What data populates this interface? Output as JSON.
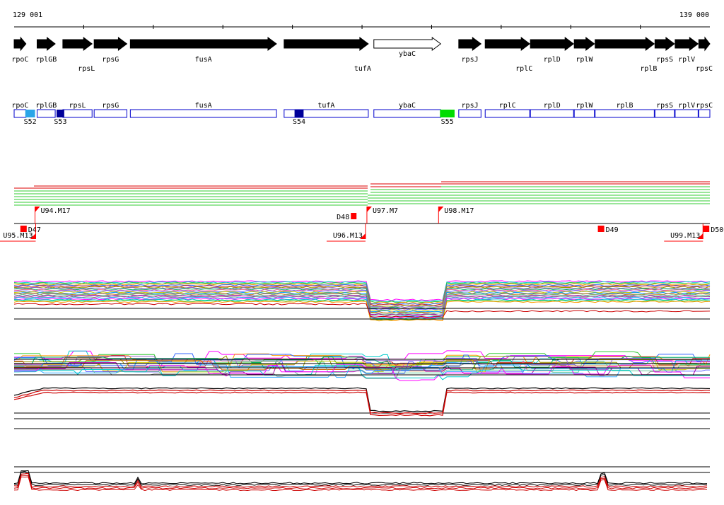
{
  "coords": {
    "start_label": "129 001",
    "end_label": "139 000",
    "start": 129001,
    "end": 139000
  },
  "genes": [
    {
      "name": "rpoC",
      "start": 129001,
      "end": 129171,
      "strand": "+",
      "label_row": "below",
      "filled": true
    },
    {
      "name": "rplGB",
      "start": 129331,
      "end": 129591,
      "strand": "+",
      "label_row": "below",
      "filled": true
    },
    {
      "name": "rpsL",
      "start": 129701,
      "end": 130121,
      "strand": "+",
      "label_row": "below2",
      "filled": true
    },
    {
      "name": "rpsG",
      "start": 130151,
      "end": 130621,
      "strand": "+",
      "label_row": "below",
      "filled": true
    },
    {
      "name": "fusA",
      "start": 130671,
      "end": 132771,
      "strand": "+",
      "label_row": "below",
      "filled": true
    },
    {
      "name": "tufA",
      "start": 132881,
      "end": 134091,
      "strand": "+",
      "label_row": "below2",
      "filled": true
    },
    {
      "name": "ybaC",
      "start": 134171,
      "end": 135131,
      "strand": "+",
      "label_row": "above",
      "filled": false
    },
    {
      "name": "rpsJ",
      "start": 135391,
      "end": 135711,
      "strand": "+",
      "label_row": "below",
      "filled": true
    },
    {
      "name": "rplC",
      "start": 135771,
      "end": 136411,
      "strand": "+",
      "label_row": "below2",
      "filled": true
    },
    {
      "name": "rplD",
      "start": 136421,
      "end": 137041,
      "strand": "+",
      "label_row": "below",
      "filled": true
    },
    {
      "name": "rplW",
      "start": 137051,
      "end": 137341,
      "strand": "+",
      "label_row": "below",
      "filled": true
    },
    {
      "name": "rplB",
      "start": 137351,
      "end": 138201,
      "strand": "+",
      "label_row": "below2",
      "filled": true
    },
    {
      "name": "rpsS",
      "start": 138211,
      "end": 138491,
      "strand": "+",
      "label_row": "below",
      "filled": true
    },
    {
      "name": "rplV",
      "start": 138501,
      "end": 138831,
      "strand": "+",
      "label_row": "below",
      "filled": true
    },
    {
      "name": "rpsC",
      "start": 138841,
      "end": 139000,
      "strand": "+",
      "label_row": "below2",
      "filled": true
    }
  ],
  "regions": [
    {
      "name": "S52",
      "start": 129161,
      "end": 129301,
      "color": "#2aa5e8"
    },
    {
      "name": "S53",
      "start": 129611,
      "end": 129721,
      "color": "#000099"
    },
    {
      "name": "S54",
      "start": 133031,
      "end": 133161,
      "color": "#000099"
    },
    {
      "name": "S55",
      "start": 135121,
      "end": 135331,
      "color": "#00dd00"
    }
  ],
  "markers": [
    {
      "label": "U94.M17",
      "pos": 129301,
      "row": "top"
    },
    {
      "label": "U97.M7",
      "pos": 134071,
      "row": "top"
    },
    {
      "label": "U98.M17",
      "pos": 135101,
      "row": "top"
    },
    {
      "label": "D47",
      "pos": 129131,
      "row": "bottom"
    },
    {
      "label": "D48",
      "pos": 133891,
      "row": "top"
    },
    {
      "label": "D49",
      "pos": 137431,
      "row": "bottom"
    },
    {
      "label": "D50",
      "pos": 138941,
      "row": "bottom"
    },
    {
      "label": "U95.M13",
      "pos": 129311,
      "row": "bottom"
    },
    {
      "label": "U96.M13",
      "pos": 134051,
      "row": "bottom"
    },
    {
      "label": "U99.M13",
      "pos": 138901,
      "row": "bottom"
    }
  ],
  "colors": {
    "gene_fill": "#000000",
    "region_outline": "#0000cc",
    "alignment_red": "#dd0000",
    "alignment_green": "#33cc33",
    "marker_red": "#ff0000"
  }
}
